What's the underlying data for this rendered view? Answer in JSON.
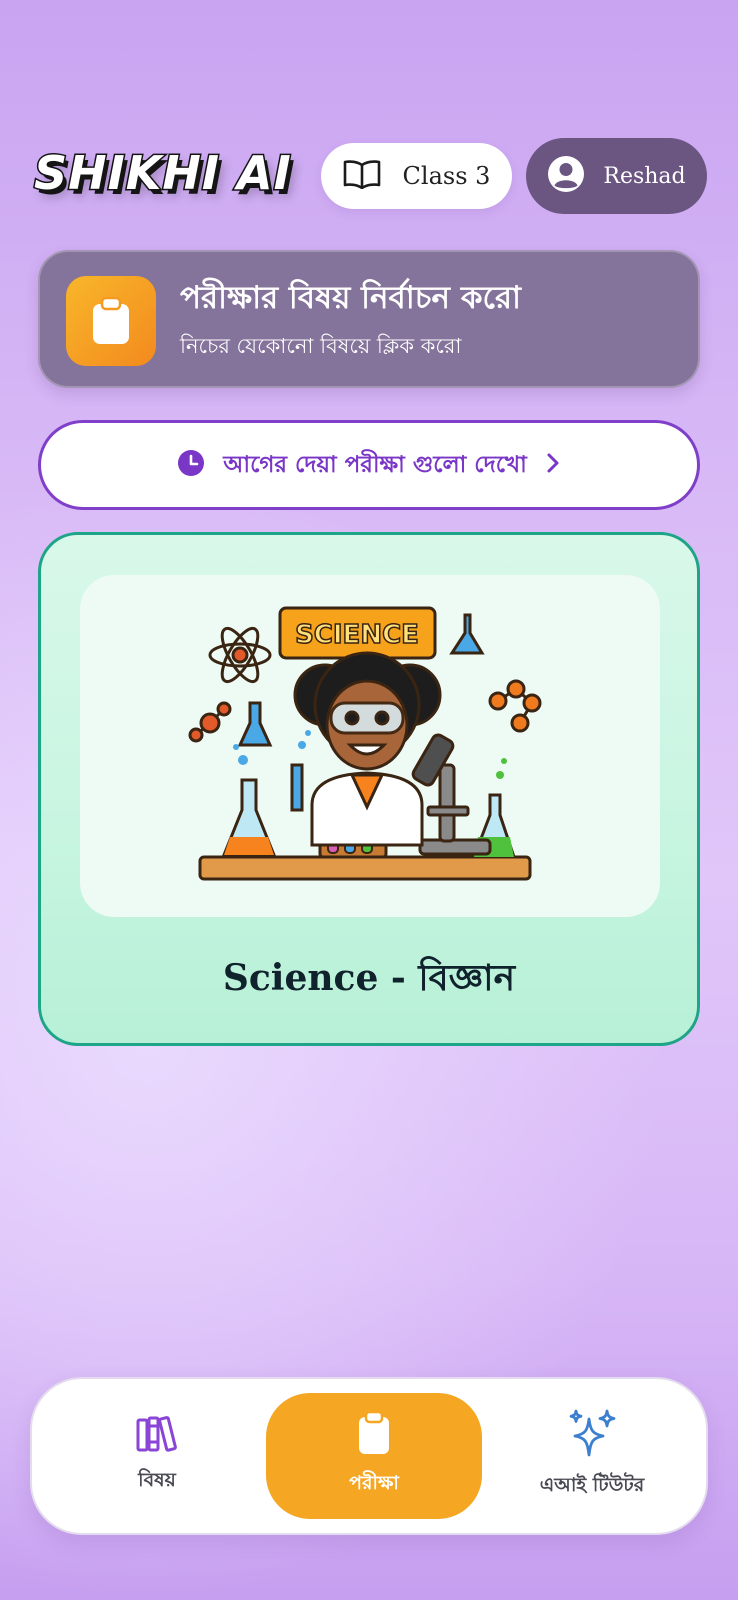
{
  "header": {
    "logo_text": "SHIKHI AI",
    "class_label": "Class 3",
    "user_name": "Reshad"
  },
  "info_card": {
    "title": "পরীক্ষার বিষয় নির্বাচন করো",
    "subtitle": "নিচের যেকোনো বিষয়ে ক্লিক করো"
  },
  "history_button": {
    "label": "আগের দেয়া পরীক্ষা গুলো দেখো"
  },
  "subjects": [
    {
      "label": "Science - বিজ্ঞান",
      "image_banner": "SCIENCE"
    }
  ],
  "bottom_nav": {
    "items": [
      {
        "label": "বিষয়",
        "icon": "books-icon",
        "active": false
      },
      {
        "label": "পরীক্ষা",
        "icon": "clipboard-icon",
        "active": true
      },
      {
        "label": "এআই টিউটর",
        "icon": "sparkles-icon",
        "active": false
      }
    ]
  },
  "colors": {
    "accent_purple": "#7a36c6",
    "nav_active": "#f5a623",
    "card_border_green": "#1ea487",
    "user_pill": "#6b5581"
  }
}
